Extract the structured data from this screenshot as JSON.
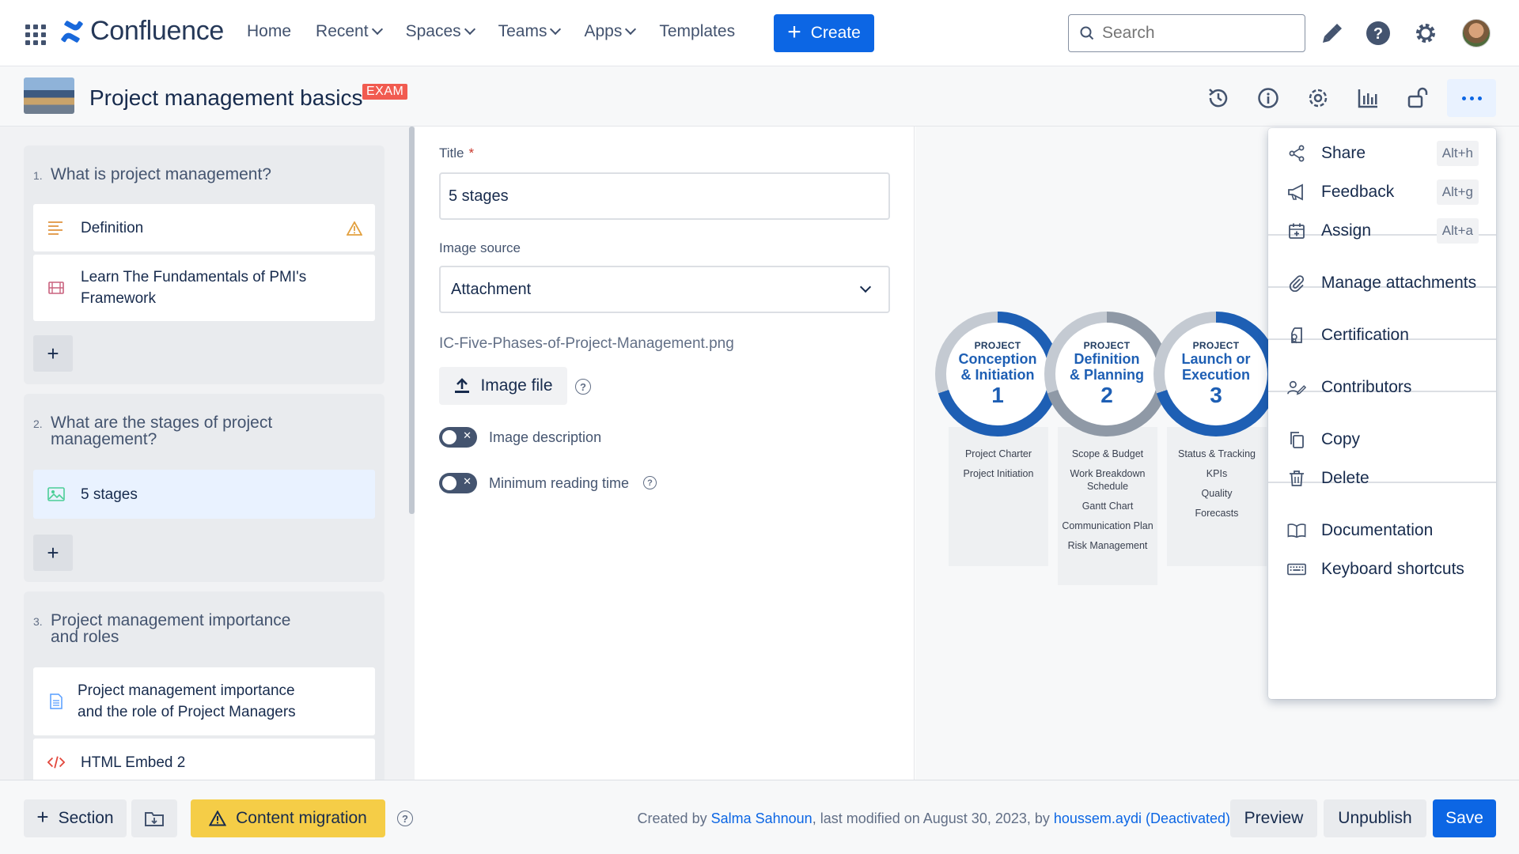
{
  "topnav": {
    "brand": "Confluence",
    "items": [
      {
        "label": "Home",
        "dropdown": false
      },
      {
        "label": "Recent",
        "dropdown": true
      },
      {
        "label": "Spaces",
        "dropdown": true
      },
      {
        "label": "Teams",
        "dropdown": true
      },
      {
        "label": "Apps",
        "dropdown": true
      },
      {
        "label": "Templates",
        "dropdown": false
      }
    ],
    "create_label": "Create",
    "search_placeholder": "Search",
    "icons": [
      "notifications-icon",
      "help-icon",
      "settings-icon",
      "avatar"
    ]
  },
  "page": {
    "title": "Project management basics",
    "badge": "EXAM",
    "header_icons": [
      "history-icon",
      "info-icon",
      "settings-icon",
      "analytics-icon",
      "unlock-icon",
      "more-icon"
    ]
  },
  "sidebar": {
    "sections": [
      {
        "number": "1.",
        "title": "What is project management?",
        "items": [
          {
            "label": "Definition",
            "icon": "text-icon",
            "warning": true
          },
          {
            "label": "Learn The Fundamentals of PMI's Framework",
            "icon": "video-icon",
            "warning": false
          }
        ]
      },
      {
        "number": "2.",
        "title": "What are the stages of project management?",
        "items": [
          {
            "label": "5 stages",
            "icon": "image-icon",
            "active": true
          }
        ]
      },
      {
        "number": "3.",
        "title": "Project management importance and roles",
        "items": [
          {
            "label": "Project management importance and the role of Project Managers",
            "icon": "document-icon"
          },
          {
            "label": "HTML Embed 2",
            "icon": "code-icon"
          }
        ]
      }
    ],
    "add_label": "+"
  },
  "form": {
    "title_label": "Title",
    "title_required": "*",
    "title_value": "5 stages",
    "source_label": "Image source",
    "source_value": "Attachment",
    "filename": "IC-Five-Phases-of-Project-Management.png",
    "image_file_label": "Image file",
    "toggle_description": "Image description",
    "toggle_reading_time": "Minimum reading time",
    "help_glyph": "?"
  },
  "preview": {
    "phases": [
      {
        "small": "PROJECT",
        "line1": "Conception",
        "line2": "& Initiation",
        "num": "1",
        "items": [
          "Project Charter",
          "Project Initiation"
        ],
        "ring": "#1e5fb4"
      },
      {
        "small": "PROJECT",
        "line1": "Definition",
        "line2": "& Planning",
        "num": "2",
        "items": [
          "Scope & Budget",
          "Work Breakdown Schedule",
          "Gantt Chart",
          "Communication Plan",
          "Risk Management"
        ],
        "ring": "#8f99a6"
      },
      {
        "small": "PROJECT",
        "line1": "Launch or",
        "line2": "Execution",
        "num": "3",
        "items": [
          "Status & Tracking",
          "KPIs",
          "Quality",
          "Forecasts"
        ],
        "ring": "#1e5fb4"
      }
    ]
  },
  "menu": {
    "items": [
      {
        "label": "Share",
        "shortcut": "Alt+h",
        "icon": "share-icon"
      },
      {
        "label": "Feedback",
        "shortcut": "Alt+g",
        "icon": "megaphone-icon"
      },
      {
        "label": "Assign",
        "shortcut": "Alt+a",
        "icon": "calendar-icon"
      },
      {
        "label": "Manage attachments",
        "shortcut": "",
        "icon": "paperclip-icon"
      },
      {
        "label": "Certification",
        "shortcut": "",
        "icon": "certificate-icon"
      },
      {
        "label": "Contributors",
        "shortcut": "",
        "icon": "contributors-icon"
      },
      {
        "label": "Copy",
        "shortcut": "",
        "icon": "copy-icon"
      },
      {
        "label": "Delete",
        "shortcut": "",
        "icon": "trash-icon"
      },
      {
        "label": "Documentation",
        "shortcut": "",
        "icon": "book-icon"
      },
      {
        "label": "Keyboard shortcuts",
        "shortcut": "",
        "icon": "keyboard-icon"
      }
    ]
  },
  "footer": {
    "section_label": "Section",
    "content_migration_label": "Content migration",
    "meta_prefix": "Created by ",
    "meta_author": "Salma Sahnoun",
    "meta_middle": ", last modified on August 30, 2023, by ",
    "meta_editor": "houssem.aydi (Deactivated)",
    "preview_label": "Preview",
    "unpublish_label": "Unpublish",
    "save_label": "Save"
  },
  "colors": {
    "primary": "#0c66e4",
    "warning": "#f5cd47",
    "badge": "#f15b50",
    "active_item": "#e9f2ff"
  }
}
